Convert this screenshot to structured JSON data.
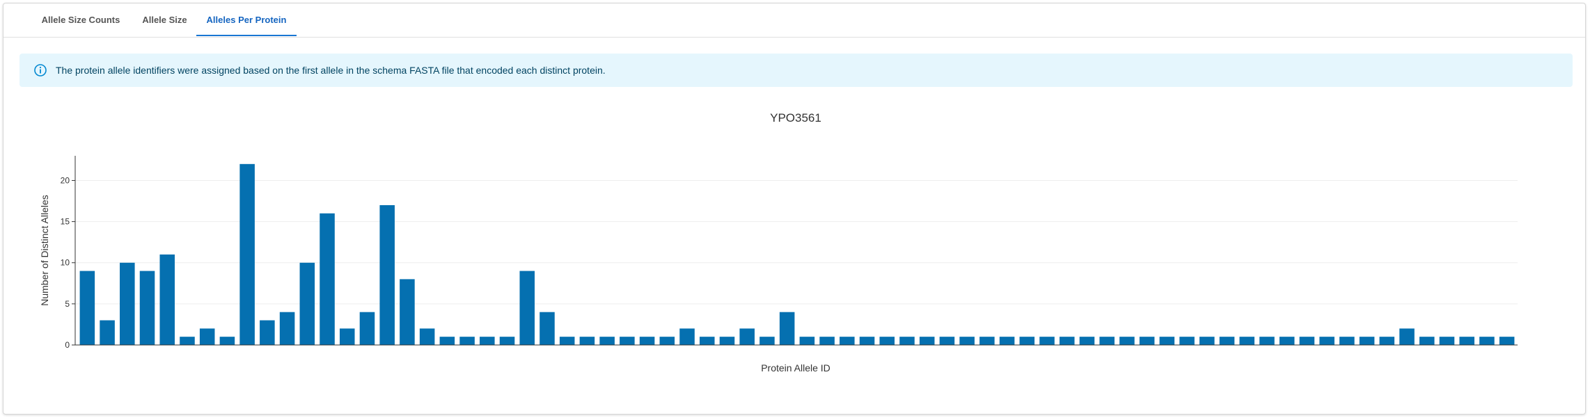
{
  "tabs": [
    {
      "label": "Allele Size Counts",
      "active": false
    },
    {
      "label": "Allele Size",
      "active": false
    },
    {
      "label": "Alleles Per Protein",
      "active": true
    }
  ],
  "alert": {
    "icon": "info-icon",
    "text": "The protein allele identifiers were assigned based on the first allele in the schema FASTA file that encoded each distinct protein.",
    "color": "#0288d1"
  },
  "chart_data": {
    "type": "bar",
    "title": "YPO3561",
    "xlabel": "Protein Allele ID",
    "ylabel": "Number of Distinct Alleles",
    "ylim": [
      0,
      23
    ],
    "yticks": [
      0,
      5,
      10,
      15,
      20
    ],
    "grid": true,
    "legend": "none",
    "bar_color": "#0570b0",
    "values": [
      9,
      3,
      10,
      9,
      11,
      1,
      2,
      1,
      22,
      3,
      4,
      10,
      16,
      2,
      4,
      17,
      8,
      2,
      1,
      1,
      1,
      1,
      9,
      4,
      1,
      1,
      1,
      1,
      1,
      1,
      2,
      1,
      1,
      2,
      1,
      4,
      1,
      1,
      1,
      1,
      1,
      1,
      1,
      1,
      1,
      1,
      1,
      1,
      1,
      1,
      1,
      1,
      1,
      1,
      1,
      1,
      1,
      1,
      1,
      1,
      1,
      1,
      1,
      1,
      1,
      1,
      2,
      1,
      1,
      1,
      1,
      1
    ]
  }
}
